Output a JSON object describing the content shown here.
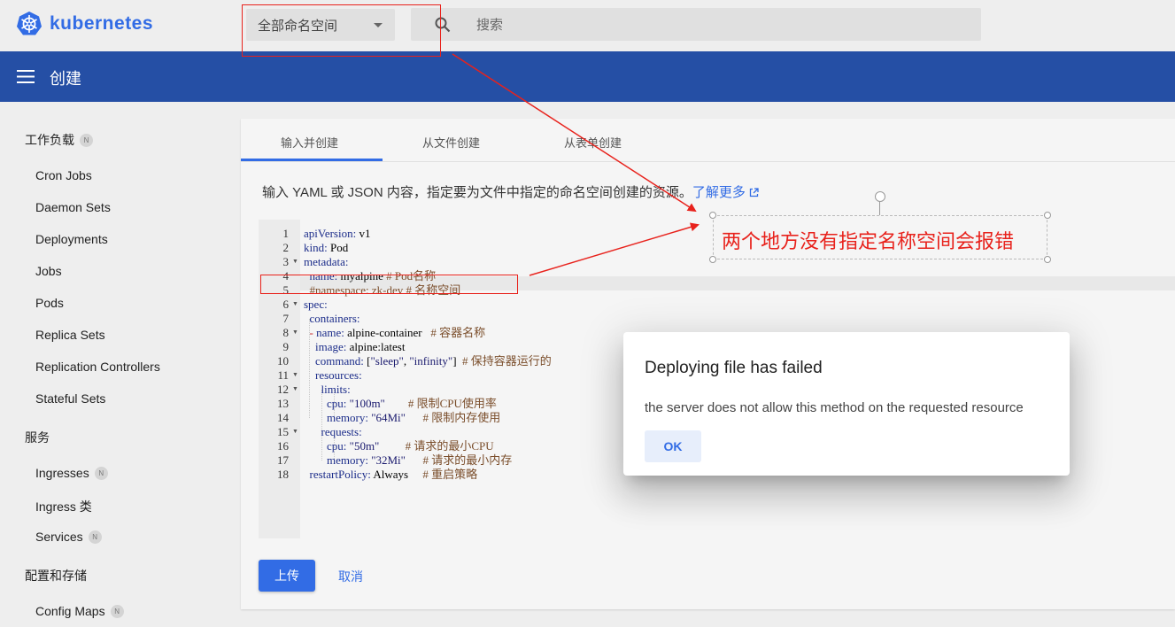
{
  "header": {
    "logo_text": "kubernetes",
    "namespace_selector": "全部命名空间",
    "search_placeholder": "搜索"
  },
  "toolbar": {
    "title": "创建"
  },
  "sidebar": {
    "sections": [
      {
        "heading": "工作负载",
        "heading_badge": "N",
        "items": [
          {
            "label": "Cron Jobs",
            "badge": ""
          },
          {
            "label": "Daemon Sets",
            "badge": ""
          },
          {
            "label": "Deployments",
            "badge": ""
          },
          {
            "label": "Jobs",
            "badge": ""
          },
          {
            "label": "Pods",
            "badge": ""
          },
          {
            "label": "Replica Sets",
            "badge": ""
          },
          {
            "label": "Replication Controllers",
            "badge": ""
          },
          {
            "label": "Stateful Sets",
            "badge": ""
          }
        ]
      },
      {
        "heading": "服务",
        "heading_badge": "",
        "items": [
          {
            "label": "Ingresses",
            "badge": "N"
          },
          {
            "label": "Ingress 类",
            "badge": ""
          },
          {
            "label": "Services",
            "badge": "N"
          }
        ]
      },
      {
        "heading": "配置和存储",
        "heading_badge": "",
        "items": [
          {
            "label": "Config Maps",
            "badge": "N"
          }
        ]
      }
    ]
  },
  "tabs": [
    "输入并创建",
    "从文件创建",
    "从表单创建"
  ],
  "instructions": {
    "text": "输入 YAML 或 JSON 内容，指定要为文件中指定的命名空间创建的资源。",
    "link": "了解更多"
  },
  "editor": {
    "lines": [
      {
        "n": "1",
        "fold": false,
        "html": "<span class=\"k\">apiVersion:</span> v1"
      },
      {
        "n": "2",
        "fold": false,
        "html": "<span class=\"k\">kind:</span> Pod"
      },
      {
        "n": "3",
        "fold": true,
        "html": "<span class=\"k\">metadata:</span>"
      },
      {
        "n": "4",
        "fold": false,
        "html": "  <span class=\"k\">name:</span> myalpine <span class=\"c\"># Pod名称</span>"
      },
      {
        "n": "5",
        "fold": false,
        "html": "  <span class=\"c\">#namespace: zk-dev # 名称空间</span>"
      },
      {
        "n": "6",
        "fold": true,
        "html": "<span class=\"k\">spec:</span>"
      },
      {
        "n": "7",
        "fold": false,
        "html": "  <span class=\"k\">containers:</span>"
      },
      {
        "n": "8",
        "fold": true,
        "html": "  <span class=\"dash\">-</span> <span class=\"k\">name:</span> alpine-container   <span class=\"c\"># 容器名称</span>"
      },
      {
        "n": "9",
        "fold": false,
        "html": "    <span class=\"k\">image:</span> alpine:latest"
      },
      {
        "n": "10",
        "fold": false,
        "html": "    <span class=\"k\">command:</span> [<span class=\"s\">\"sleep\"</span>, <span class=\"s\">\"infinity\"</span>]  <span class=\"c\"># 保持容器运行的</span>"
      },
      {
        "n": "11",
        "fold": true,
        "html": "    <span class=\"k\">resources:</span>"
      },
      {
        "n": "12",
        "fold": true,
        "html": "      <span class=\"k\">limits:</span>"
      },
      {
        "n": "13",
        "fold": false,
        "html": "        <span class=\"k\">cpu:</span> <span class=\"s\">\"100m\"</span>        <span class=\"c\"># 限制CPU使用率</span>"
      },
      {
        "n": "14",
        "fold": false,
        "html": "        <span class=\"k\">memory:</span> <span class=\"s\">\"64Mi\"</span>      <span class=\"c\"># 限制内存使用</span>"
      },
      {
        "n": "15",
        "fold": true,
        "html": "      <span class=\"k\">requests:</span>"
      },
      {
        "n": "16",
        "fold": false,
        "html": "        <span class=\"k\">cpu:</span> <span class=\"s\">\"50m\"</span>         <span class=\"c\"># 请求的最小CPU</span>"
      },
      {
        "n": "17",
        "fold": false,
        "html": "        <span class=\"k\">memory:</span> <span class=\"s\">\"32Mi\"</span>      <span class=\"c\"># 请求的最小内存</span>"
      },
      {
        "n": "18",
        "fold": false,
        "html": "  <span class=\"k\">restartPolicy:</span> Always     <span class=\"c\"># 重启策略</span>"
      }
    ]
  },
  "actions": {
    "upload": "上传",
    "cancel": "取消"
  },
  "dialog": {
    "title": "Deploying file has failed",
    "message": "the server does not allow this method on the requested resource",
    "ok": "OK"
  },
  "annotation": {
    "text": "两个地方没有指定名称空间会报错",
    "color": "#e8221c"
  },
  "colors": {
    "brand": "#326ce5",
    "toolbar": "#254fa5"
  }
}
